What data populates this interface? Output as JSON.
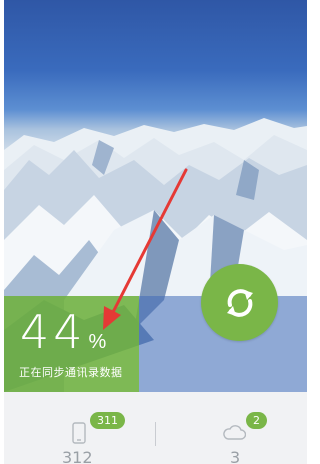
{
  "progress": {
    "percent_value": "44",
    "percent_sign": "%",
    "status_text": "正在同步通讯录数据"
  },
  "stats": {
    "local": {
      "icon": "phone-icon",
      "badge": "311",
      "count": "312"
    },
    "cloud": {
      "icon": "cloud-icon",
      "badge": "2",
      "count": "3"
    }
  },
  "colors": {
    "accent_green": "#7ab648",
    "annotation_red": "#e53935"
  }
}
